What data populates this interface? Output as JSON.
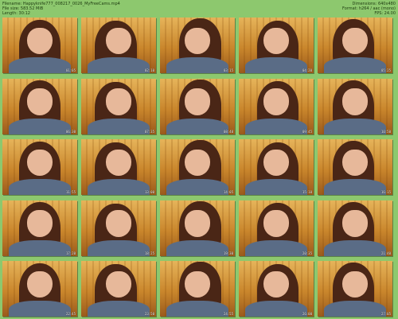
{
  "meta": {
    "filename": "Filename: Happyknife777_008217_0026_MyFreeCams.mp4",
    "filesize": "File size: 583.52 MiB",
    "length": "Length: 30:12",
    "dimensions": "Dimensions: 640x480",
    "format": "Format: h264 / aac (mono)",
    "fps": "FPS: 24.00"
  },
  "thumbnails": [
    {
      "ts": "01:05"
    },
    {
      "ts": "02:10"
    },
    {
      "ts": "03:15"
    },
    {
      "ts": "04:20"
    },
    {
      "ts": "05:25"
    },
    {
      "ts": "06:30"
    },
    {
      "ts": "07:35"
    },
    {
      "ts": "08:40"
    },
    {
      "ts": "09:45"
    },
    {
      "ts": "10:50"
    },
    {
      "ts": "11:55"
    },
    {
      "ts": "13:00"
    },
    {
      "ts": "14:05"
    },
    {
      "ts": "15:10"
    },
    {
      "ts": "16:15"
    },
    {
      "ts": "17:20"
    },
    {
      "ts": "18:25"
    },
    {
      "ts": "19:30"
    },
    {
      "ts": "20:35"
    },
    {
      "ts": "21:40"
    },
    {
      "ts": "22:45"
    },
    {
      "ts": "23:50"
    },
    {
      "ts": "24:55"
    },
    {
      "ts": "26:00"
    },
    {
      "ts": "27:05"
    }
  ],
  "colors": {
    "background": "#8dc86e",
    "hair": "#4a2616",
    "skin": "#e7b89a",
    "sweater": "#5a6c86"
  }
}
